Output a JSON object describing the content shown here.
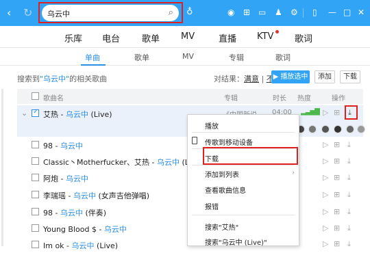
{
  "header": {
    "search_value": "乌云中",
    "nav_back": "‹",
    "nav_refresh": "↻",
    "colors": {
      "accent": "#31a4f5",
      "highlight": "#e02020"
    }
  },
  "main_tabs": [
    {
      "label": "乐库"
    },
    {
      "label": "电台"
    },
    {
      "label": "歌单"
    },
    {
      "label": "MV"
    },
    {
      "label": "直播"
    },
    {
      "label": "KTV"
    },
    {
      "label": "歌词"
    }
  ],
  "sub_tabs": [
    {
      "label": "单曲",
      "active": true
    },
    {
      "label": "歌单"
    },
    {
      "label": "MV"
    },
    {
      "label": "专辑"
    },
    {
      "label": "歌词"
    }
  ],
  "search_info": {
    "prefix": "搜索到",
    "keyword": "\"乌云中\"",
    "suffix": "的相关歌曲"
  },
  "rating": {
    "label": "对结果：",
    "satisfied": "满意",
    "unsatisfied": "不满意"
  },
  "buttons": {
    "play_selected": "播放选中",
    "add": "添加",
    "download": "下载"
  },
  "table_header": {
    "name": "歌曲名",
    "album": "专辑",
    "duration": "时长",
    "heat": "热度",
    "action": "操作"
  },
  "songs": [
    {
      "title": "艾热 - ",
      "artist": "乌云中",
      "extra": " (Live)",
      "album": "《中国新说...",
      "duration": "04:00",
      "checked": true
    },
    {
      "title": "98 - ",
      "artist": "乌云中",
      "extra": ""
    },
    {
      "title": "Classic丶Motherfucker、艾热 - ",
      "artist": "乌云中",
      "extra": " (Live)"
    },
    {
      "title": "阿炮 - ",
      "artist": "乌云中",
      "extra": ""
    },
    {
      "title": "李瑞瑶 - ",
      "artist": "乌云中",
      "extra": " (女声吉他弹唱)"
    },
    {
      "title": "98 - ",
      "artist": "乌云中",
      "extra": " (伴奏)"
    },
    {
      "title": "Young Blood $ - ",
      "artist": "乌云中",
      "extra": ""
    },
    {
      "title": "Im ok - ",
      "artist": "乌云中",
      "extra": " (Live)"
    }
  ],
  "context_menu": {
    "items": [
      {
        "label": "播放"
      },
      {
        "label": "传歌到移动设备"
      },
      {
        "label": "下载"
      },
      {
        "label": "添加到列表"
      },
      {
        "label": "查看歌曲信息"
      },
      {
        "label": "报错"
      },
      {
        "label": "搜索\"艾热\""
      },
      {
        "label": "搜索\"乌云中 (Live)\""
      }
    ]
  }
}
